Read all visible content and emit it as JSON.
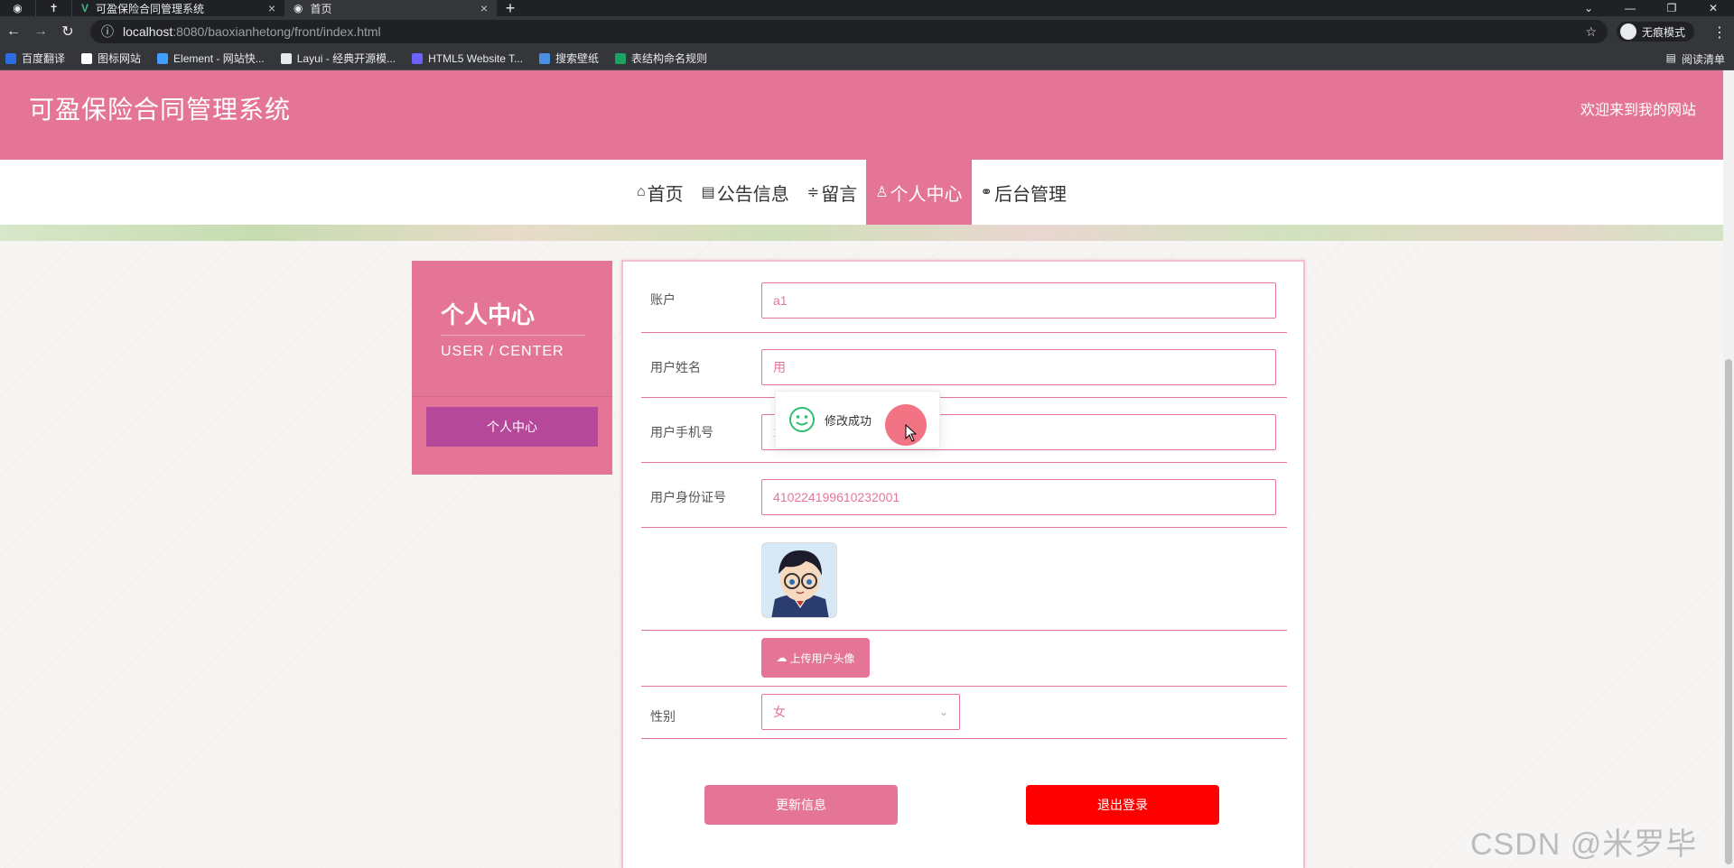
{
  "browser": {
    "tabs": [
      {
        "title": "可盈保险合同管理系统",
        "active": false
      },
      {
        "title": "首页",
        "active": true
      }
    ],
    "url_host": "localhost",
    "url_path": ":8080/baoxianhetong/front/index.html",
    "profile_label": "无痕模式",
    "bookmarks": [
      {
        "label": "百度翻译",
        "color": "#2b6de0"
      },
      {
        "label": "图标网站",
        "color": "#ffffff"
      },
      {
        "label": "Element - 网站快...",
        "color": "#409eff"
      },
      {
        "label": "Layui - 经典开源模...",
        "color": "#e8eaed"
      },
      {
        "label": "HTML5 Website T...",
        "color": "#6c63ff"
      },
      {
        "label": "搜索壁纸",
        "color": "#4a90e2"
      },
      {
        "label": "表结构命名规则",
        "color": "#1aa260"
      }
    ],
    "reading_list": "阅读清单"
  },
  "header": {
    "title": "可盈保险合同管理系统",
    "welcome": "欢迎来到我的网站"
  },
  "nav": {
    "items": [
      {
        "icon": "home-icon",
        "glyph": "⌂",
        "label": "首页"
      },
      {
        "icon": "notice-icon",
        "glyph": "▤",
        "label": "公告信息"
      },
      {
        "icon": "sliders-icon",
        "glyph": "≑",
        "label": "留言"
      },
      {
        "icon": "user-icon",
        "glyph": "♙",
        "label": "个人中心",
        "active": true
      },
      {
        "icon": "link-icon",
        "glyph": "⚭",
        "label": "后台管理"
      }
    ]
  },
  "sidebar": {
    "title": "个人中心",
    "subtitle": "USER / CENTER",
    "button": "个人中心"
  },
  "form": {
    "account_label": "账户",
    "account_value": "a1",
    "name_label": "用户姓名",
    "name_value": "用",
    "phone_label": "用户手机号",
    "phone_value": "17703786901",
    "idcard_label": "用户身份证号",
    "idcard_value": "410224199610232001",
    "upload_label": "上传用户头像",
    "gender_label": "性别",
    "gender_value": "女",
    "update_button": "更新信息",
    "logout_button": "退出登录"
  },
  "toast": {
    "message": "修改成功"
  },
  "colors": {
    "primary": "#e57597",
    "sidebar_button": "#b6489a",
    "logout": "#ff0000"
  },
  "watermark": "CSDN @米罗毕设"
}
